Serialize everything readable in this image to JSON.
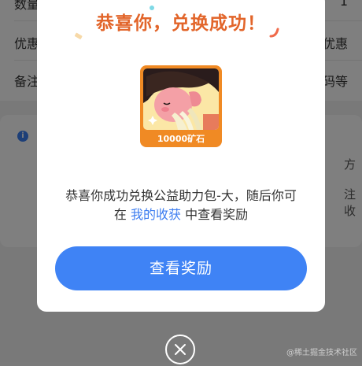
{
  "background": {
    "rows": [
      {
        "label": "数量",
        "value": "1"
      },
      {
        "label": "优惠",
        "value": "优惠"
      },
      {
        "label": "备注",
        "value": "码等"
      }
    ],
    "info_icon_glyph": "i",
    "side_texts": [
      "方",
      "注",
      "收"
    ]
  },
  "modal": {
    "title": "恭喜你，兑换成功！",
    "reward_label": "10000矿石",
    "message_line1": "恭喜你成功兑换公益助力包-大，随后你可",
    "message_line2_before": "在 ",
    "message_link": "我的收获",
    "message_line2_after": " 中查看奖励",
    "button_label": "查看奖励",
    "colors": {
      "title": "#e2652a",
      "button": "#3f83f5",
      "link": "#3d7df0"
    }
  },
  "close_icon": "close-icon",
  "watermark": "@稀土掘金技术社区"
}
